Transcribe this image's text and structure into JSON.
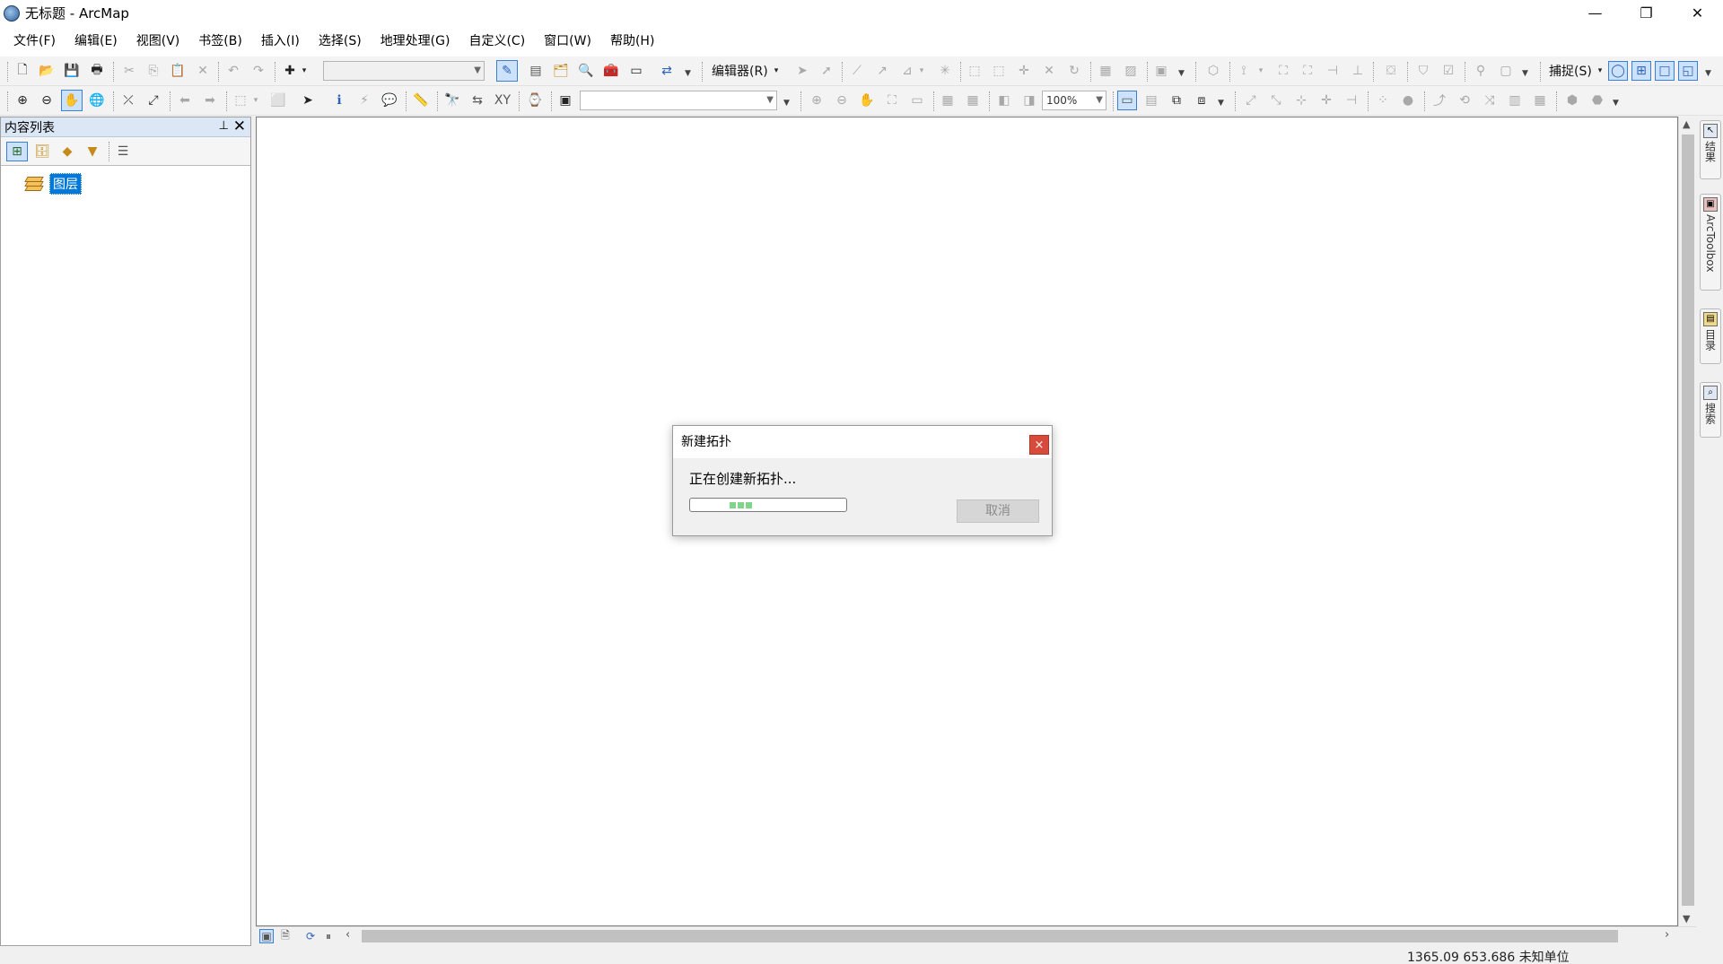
{
  "window": {
    "title": "无标题 - ArcMap",
    "minimize_glyph": "—",
    "restore_glyph": "❐",
    "close_glyph": "✕"
  },
  "menu": [
    "文件(F)",
    "编辑(E)",
    "视图(V)",
    "书签(B)",
    "插入(I)",
    "选择(S)",
    "地理处理(G)",
    "自定义(C)",
    "窗口(W)",
    "帮助(H)"
  ],
  "toolbar": {
    "editor_label": "编辑器(R)",
    "snapping_label": "捕捉(S)",
    "zoom_level": "100%",
    "scale_value": "",
    "layer_combo_value": ""
  },
  "toc": {
    "title": "内容列表",
    "pin_glyph": "📌",
    "close_glyph": "✕",
    "root_layer": "图层"
  },
  "dock_tabs": [
    {
      "label": "结果",
      "icon": "results-icon"
    },
    {
      "label": "ArcToolbox",
      "icon": "arctoolbox-icon"
    },
    {
      "label": "目录",
      "icon": "catalog-icon"
    },
    {
      "label": "搜索",
      "icon": "search-icon"
    }
  ],
  "status": {
    "coordinates": "1365.09  653.686 未知单位"
  },
  "dialog": {
    "title": "新建拓扑",
    "message": "正在创建新拓扑...",
    "cancel_label": "取消",
    "close_glyph": "×",
    "progress_state": "indeterminate"
  },
  "colors": {
    "selection_blue": "#0078d7",
    "close_red": "#d84a3a",
    "progress_green": "#7fd58a",
    "toc_header": "#dbe7f5"
  }
}
